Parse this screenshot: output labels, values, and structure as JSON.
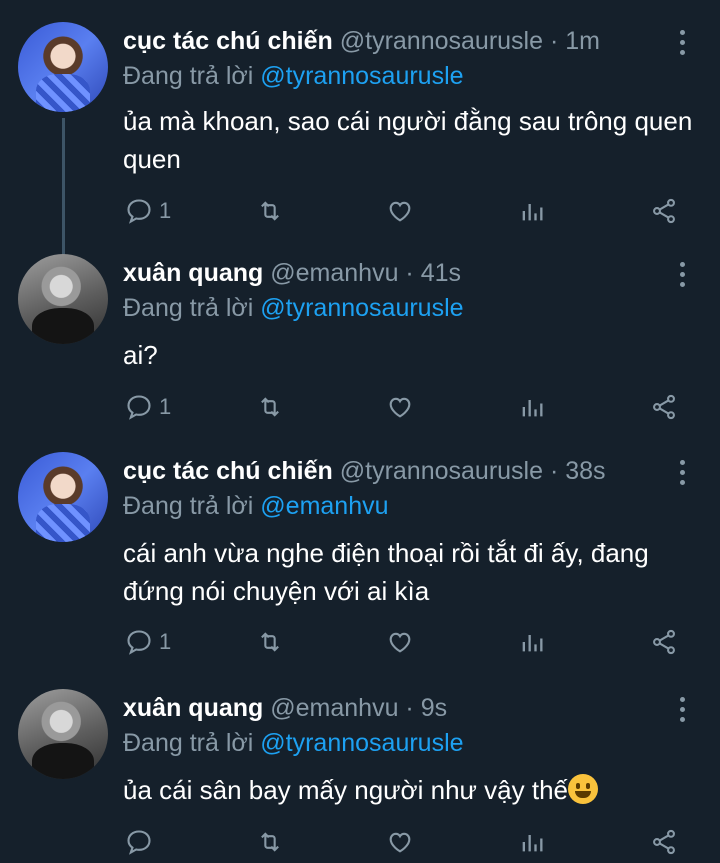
{
  "tweets": [
    {
      "name": "cục tác chú chiến",
      "handle": "@tyrannosaurusle · 1m",
      "reply_prefix": "Đang trả lời ",
      "reply_to": "@tyrannosaurusle",
      "text": "ủa mà khoan, sao cái người đằng sau trông quen quen",
      "reply_count": "1",
      "avatar": "blue-avatar"
    },
    {
      "name": "xuân quang",
      "handle": "@emanhvu · 41s",
      "reply_prefix": "Đang trả lời ",
      "reply_to": "@tyrannosaurusle",
      "text": "ai?",
      "reply_count": "1",
      "avatar": "bw-avatar"
    },
    {
      "name": "cục tác chú chiến",
      "handle": "@tyrannosaurusle · 38s",
      "reply_prefix": "Đang trả lời ",
      "reply_to": "@emanhvu",
      "text": "cái anh vừa nghe điện thoại rồi tắt đi ấy, đang đứng nói chuyện với ai kìa",
      "reply_count": "1",
      "avatar": "blue-avatar"
    },
    {
      "name": "xuân quang",
      "handle": "@emanhvu · 9s",
      "reply_prefix": "Đang trả lời ",
      "reply_to": "@tyrannosaurusle",
      "text": "ủa cái sân bay mấy người như vậy thế",
      "reply_count": "",
      "avatar": "bw-avatar"
    }
  ],
  "colors": {
    "background": "#15202b",
    "secondary_text": "#8899a6",
    "link": "#1da1f2"
  },
  "icons": [
    "reply-icon",
    "retweet-icon",
    "like-icon",
    "analytics-icon",
    "share-icon",
    "more-icon",
    "grinning-emoji"
  ]
}
